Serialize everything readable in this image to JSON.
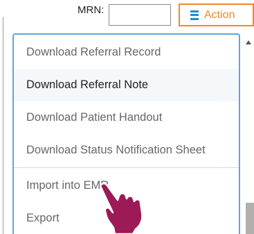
{
  "toolbar": {
    "mrn_label": "MRN:",
    "mrn_value": "",
    "action_label": "Action",
    "action_icon": "menu-icon"
  },
  "menu": {
    "items": [
      {
        "label": "Download Referral Record",
        "hovered": false
      },
      {
        "label": "Download Referral Note",
        "hovered": true
      },
      {
        "label": "Download Patient Handout",
        "hovered": false
      },
      {
        "label": "Download Status Notification Sheet",
        "hovered": false
      },
      {
        "label": "Import into EMR",
        "hovered": false
      },
      {
        "label": "Export",
        "hovered": false
      }
    ]
  },
  "cursor": {
    "icon": "pointing-hand-icon",
    "color": "#9c1a55"
  },
  "colors": {
    "accent": "#e98a2c",
    "menu_border": "#5aa6e0",
    "icon_blue": "#1f8bd6"
  }
}
